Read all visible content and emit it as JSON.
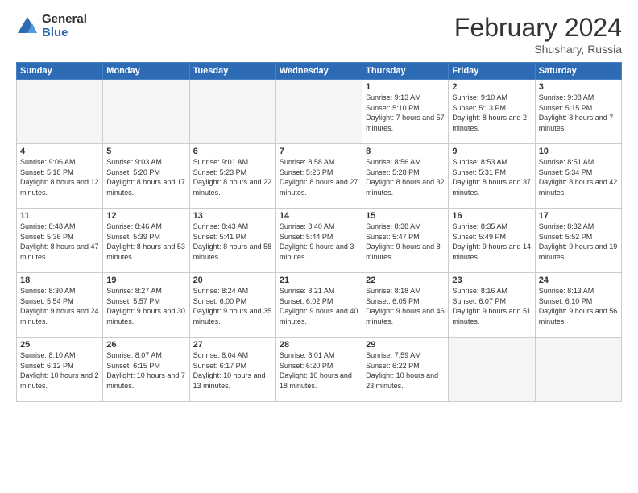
{
  "header": {
    "logo_general": "General",
    "logo_blue": "Blue",
    "month_title": "February 2024",
    "subtitle": "Shushary, Russia"
  },
  "weekdays": [
    "Sunday",
    "Monday",
    "Tuesday",
    "Wednesday",
    "Thursday",
    "Friday",
    "Saturday"
  ],
  "weeks": [
    [
      {
        "day": "",
        "empty": true
      },
      {
        "day": "",
        "empty": true
      },
      {
        "day": "",
        "empty": true
      },
      {
        "day": "",
        "empty": true
      },
      {
        "day": "1",
        "sunrise": "Sunrise: 9:13 AM",
        "sunset": "Sunset: 5:10 PM",
        "daylight": "Daylight: 7 hours and 57 minutes."
      },
      {
        "day": "2",
        "sunrise": "Sunrise: 9:10 AM",
        "sunset": "Sunset: 5:13 PM",
        "daylight": "Daylight: 8 hours and 2 minutes."
      },
      {
        "day": "3",
        "sunrise": "Sunrise: 9:08 AM",
        "sunset": "Sunset: 5:15 PM",
        "daylight": "Daylight: 8 hours and 7 minutes."
      }
    ],
    [
      {
        "day": "4",
        "sunrise": "Sunrise: 9:06 AM",
        "sunset": "Sunset: 5:18 PM",
        "daylight": "Daylight: 8 hours and 12 minutes."
      },
      {
        "day": "5",
        "sunrise": "Sunrise: 9:03 AM",
        "sunset": "Sunset: 5:20 PM",
        "daylight": "Daylight: 8 hours and 17 minutes."
      },
      {
        "day": "6",
        "sunrise": "Sunrise: 9:01 AM",
        "sunset": "Sunset: 5:23 PM",
        "daylight": "Daylight: 8 hours and 22 minutes."
      },
      {
        "day": "7",
        "sunrise": "Sunrise: 8:58 AM",
        "sunset": "Sunset: 5:26 PM",
        "daylight": "Daylight: 8 hours and 27 minutes."
      },
      {
        "day": "8",
        "sunrise": "Sunrise: 8:56 AM",
        "sunset": "Sunset: 5:28 PM",
        "daylight": "Daylight: 8 hours and 32 minutes."
      },
      {
        "day": "9",
        "sunrise": "Sunrise: 8:53 AM",
        "sunset": "Sunset: 5:31 PM",
        "daylight": "Daylight: 8 hours and 37 minutes."
      },
      {
        "day": "10",
        "sunrise": "Sunrise: 8:51 AM",
        "sunset": "Sunset: 5:34 PM",
        "daylight": "Daylight: 8 hours and 42 minutes."
      }
    ],
    [
      {
        "day": "11",
        "sunrise": "Sunrise: 8:48 AM",
        "sunset": "Sunset: 5:36 PM",
        "daylight": "Daylight: 8 hours and 47 minutes."
      },
      {
        "day": "12",
        "sunrise": "Sunrise: 8:46 AM",
        "sunset": "Sunset: 5:39 PM",
        "daylight": "Daylight: 8 hours and 53 minutes."
      },
      {
        "day": "13",
        "sunrise": "Sunrise: 8:43 AM",
        "sunset": "Sunset: 5:41 PM",
        "daylight": "Daylight: 8 hours and 58 minutes."
      },
      {
        "day": "14",
        "sunrise": "Sunrise: 8:40 AM",
        "sunset": "Sunset: 5:44 PM",
        "daylight": "Daylight: 9 hours and 3 minutes."
      },
      {
        "day": "15",
        "sunrise": "Sunrise: 8:38 AM",
        "sunset": "Sunset: 5:47 PM",
        "daylight": "Daylight: 9 hours and 8 minutes."
      },
      {
        "day": "16",
        "sunrise": "Sunrise: 8:35 AM",
        "sunset": "Sunset: 5:49 PM",
        "daylight": "Daylight: 9 hours and 14 minutes."
      },
      {
        "day": "17",
        "sunrise": "Sunrise: 8:32 AM",
        "sunset": "Sunset: 5:52 PM",
        "daylight": "Daylight: 9 hours and 19 minutes."
      }
    ],
    [
      {
        "day": "18",
        "sunrise": "Sunrise: 8:30 AM",
        "sunset": "Sunset: 5:54 PM",
        "daylight": "Daylight: 9 hours and 24 minutes."
      },
      {
        "day": "19",
        "sunrise": "Sunrise: 8:27 AM",
        "sunset": "Sunset: 5:57 PM",
        "daylight": "Daylight: 9 hours and 30 minutes."
      },
      {
        "day": "20",
        "sunrise": "Sunrise: 8:24 AM",
        "sunset": "Sunset: 6:00 PM",
        "daylight": "Daylight: 9 hours and 35 minutes."
      },
      {
        "day": "21",
        "sunrise": "Sunrise: 8:21 AM",
        "sunset": "Sunset: 6:02 PM",
        "daylight": "Daylight: 9 hours and 40 minutes."
      },
      {
        "day": "22",
        "sunrise": "Sunrise: 8:18 AM",
        "sunset": "Sunset: 6:05 PM",
        "daylight": "Daylight: 9 hours and 46 minutes."
      },
      {
        "day": "23",
        "sunrise": "Sunrise: 8:16 AM",
        "sunset": "Sunset: 6:07 PM",
        "daylight": "Daylight: 9 hours and 51 minutes."
      },
      {
        "day": "24",
        "sunrise": "Sunrise: 8:13 AM",
        "sunset": "Sunset: 6:10 PM",
        "daylight": "Daylight: 9 hours and 56 minutes."
      }
    ],
    [
      {
        "day": "25",
        "sunrise": "Sunrise: 8:10 AM",
        "sunset": "Sunset: 6:12 PM",
        "daylight": "Daylight: 10 hours and 2 minutes."
      },
      {
        "day": "26",
        "sunrise": "Sunrise: 8:07 AM",
        "sunset": "Sunset: 6:15 PM",
        "daylight": "Daylight: 10 hours and 7 minutes."
      },
      {
        "day": "27",
        "sunrise": "Sunrise: 8:04 AM",
        "sunset": "Sunset: 6:17 PM",
        "daylight": "Daylight: 10 hours and 13 minutes."
      },
      {
        "day": "28",
        "sunrise": "Sunrise: 8:01 AM",
        "sunset": "Sunset: 6:20 PM",
        "daylight": "Daylight: 10 hours and 18 minutes."
      },
      {
        "day": "29",
        "sunrise": "Sunrise: 7:59 AM",
        "sunset": "Sunset: 6:22 PM",
        "daylight": "Daylight: 10 hours and 23 minutes."
      },
      {
        "day": "",
        "empty": true
      },
      {
        "day": "",
        "empty": true
      }
    ]
  ]
}
